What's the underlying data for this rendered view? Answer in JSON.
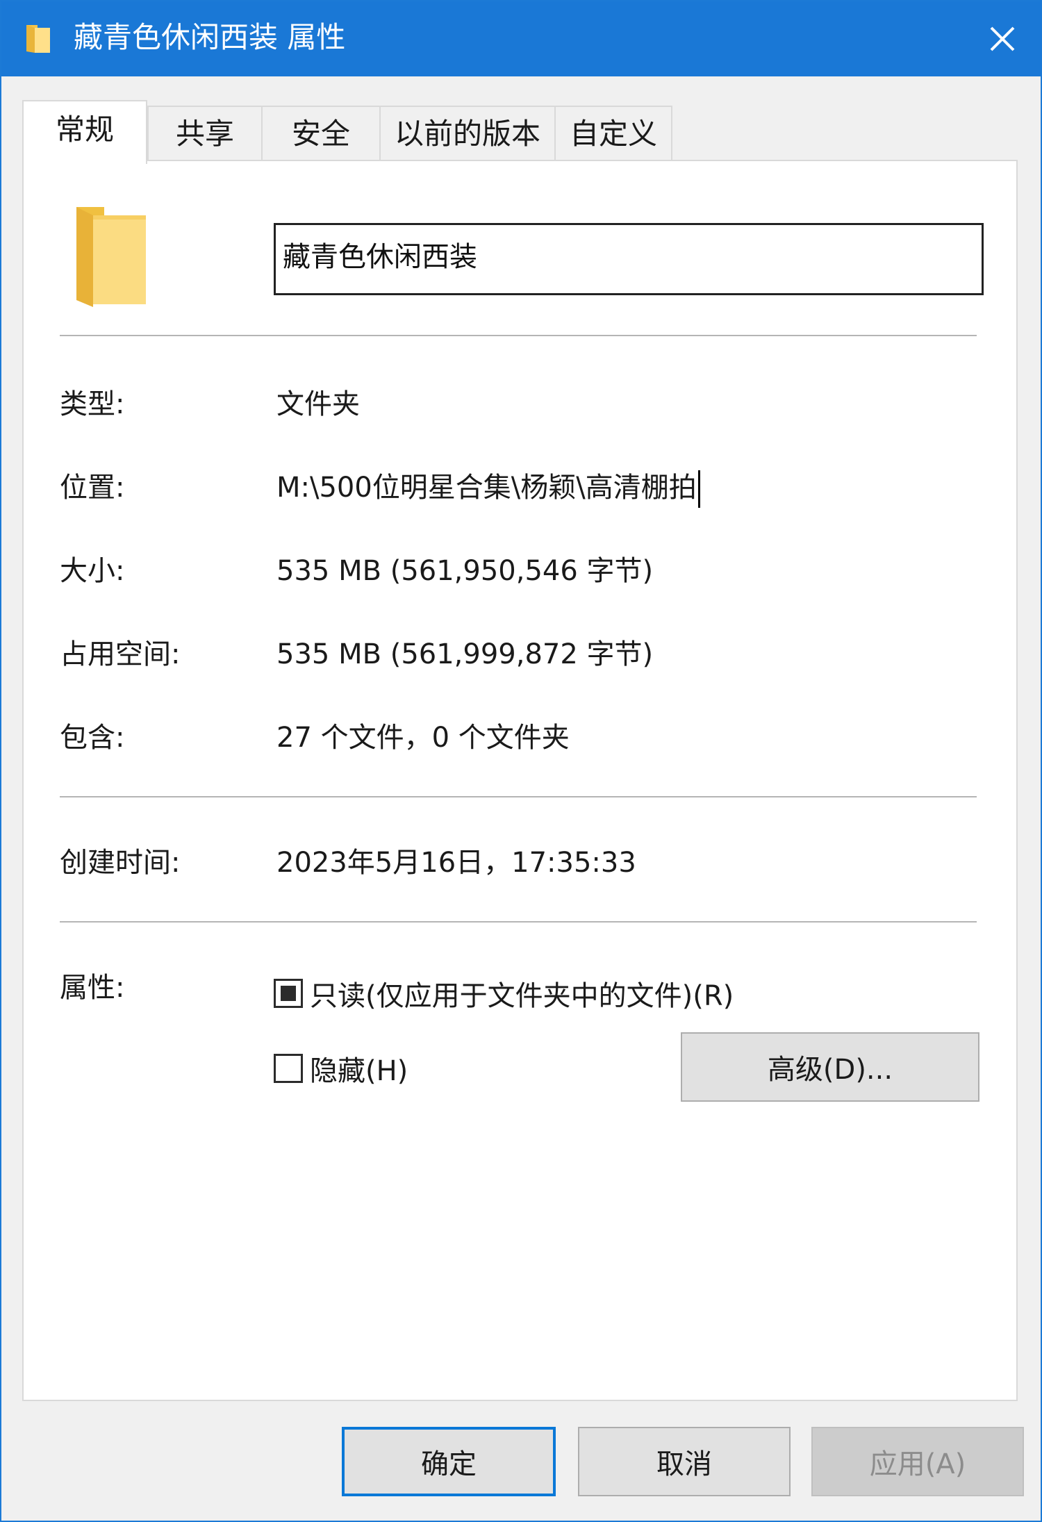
{
  "window": {
    "title": "藏青色休闲西装 属性"
  },
  "tabs": [
    {
      "label": "常规"
    },
    {
      "label": "共享"
    },
    {
      "label": "安全"
    },
    {
      "label": "以前的版本"
    },
    {
      "label": "自定义"
    }
  ],
  "general": {
    "name_value": "藏青色休闲西装",
    "type_label": "类型:",
    "type_value": "文件夹",
    "location_label": "位置:",
    "location_value": "M:\\500位明星合集\\杨颖\\高清棚拍",
    "size_label": "大小:",
    "size_value": "535 MB (561,950,546 字节)",
    "size_on_disk_label": "占用空间:",
    "size_on_disk_value": "535 MB (561,999,872 字节)",
    "contains_label": "包含:",
    "contains_value": "27 个文件，0 个文件夹",
    "created_label": "创建时间:",
    "created_value": "2023年5月16日，17:35:33",
    "attributes_label": "属性:",
    "readonly_label": "只读(仅应用于文件夹中的文件)(R)",
    "readonly_state": "indeterminate",
    "hidden_label": "隐藏(H)",
    "hidden_checked": false,
    "advanced_button": "高级(D)..."
  },
  "footer": {
    "ok_label": "确定",
    "cancel_label": "取消",
    "apply_label": "应用(A)"
  },
  "icons": {
    "title": "folder-icon",
    "close": "close-icon",
    "big_folder": "folder-icon"
  },
  "colors": {
    "titlebar": "#1a78d6",
    "accent": "#0a78d7",
    "folder": "#f5d26b"
  }
}
